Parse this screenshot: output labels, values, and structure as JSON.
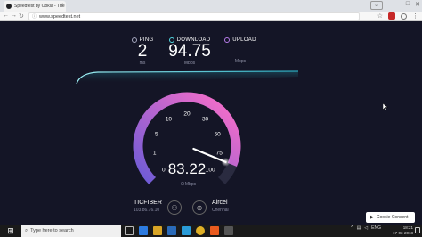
{
  "browser": {
    "tab_title": "Speedtest by Ookla - The",
    "tab_close": "×",
    "url": "www.speedtest.net",
    "window_controls": [
      "–",
      "□",
      "✕"
    ]
  },
  "stats": {
    "ping": {
      "label": "PING",
      "value": "2",
      "unit": "ms",
      "icon_color": "#a6a8c0"
    },
    "download": {
      "label": "DOWNLOAD",
      "value": "94.75",
      "unit": "Mbps",
      "icon_color": "#51d7e0"
    },
    "upload": {
      "label": "UPLOAD",
      "value": "",
      "unit": "Mbps",
      "icon_color": "#b57be8"
    }
  },
  "gauge": {
    "scale_labels": [
      "0",
      "1",
      "5",
      "10",
      "20",
      "30",
      "50",
      "75",
      "100"
    ],
    "value": "83.22",
    "unit": "Mbps",
    "gradient_start": "#6b5bd6",
    "gradient_end": "#ff6fc8"
  },
  "isp": {
    "name": "TICFIBER",
    "ip": "103.86.76.10"
  },
  "server": {
    "name": "Aircel",
    "location": "Chennai"
  },
  "cookie": {
    "label": "Cookie Consent",
    "icon": "shield-icon"
  },
  "taskbar": {
    "search_placeholder": "Type here to search",
    "tray_lang": "ENG",
    "time": "18:21",
    "date": "17-03-2018"
  },
  "colors": {
    "background": "#141526",
    "accent_cyan": "#51d7e0"
  }
}
